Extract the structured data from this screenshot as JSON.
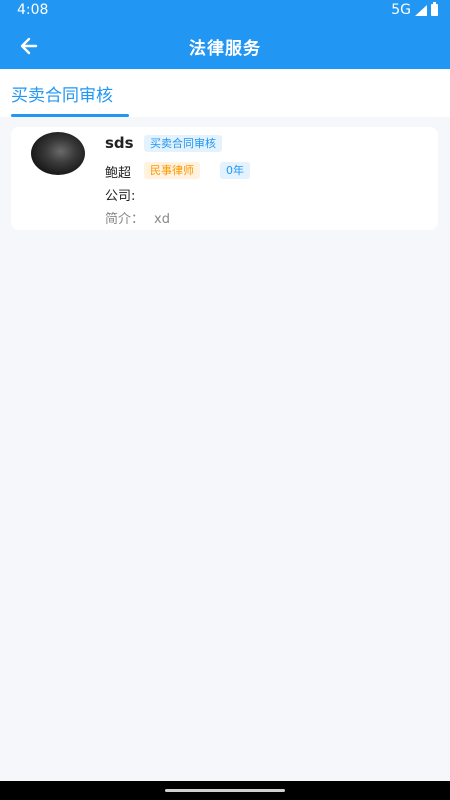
{
  "status_bar": {
    "time": "4:08",
    "network": "5G"
  },
  "app_bar": {
    "title": "法律服务"
  },
  "tabs": [
    {
      "label": "买卖合同审核",
      "active": true
    }
  ],
  "lawyer_card": {
    "service_name": "sds",
    "service_tag": "买卖合同审核",
    "lawyer_name": "鲍超",
    "lawyer_type": "民事律师",
    "experience": "0年",
    "company_label": "公司:",
    "company_value": "",
    "intro_label": "简介：",
    "intro_value": "xd"
  },
  "colors": {
    "primary": "#2196f3",
    "tag_orange": "#ff9800",
    "background": "#f5f7fa"
  },
  "icons": {
    "back": "arrow-left-icon",
    "signal": "signal-icon",
    "battery": "battery-icon"
  }
}
